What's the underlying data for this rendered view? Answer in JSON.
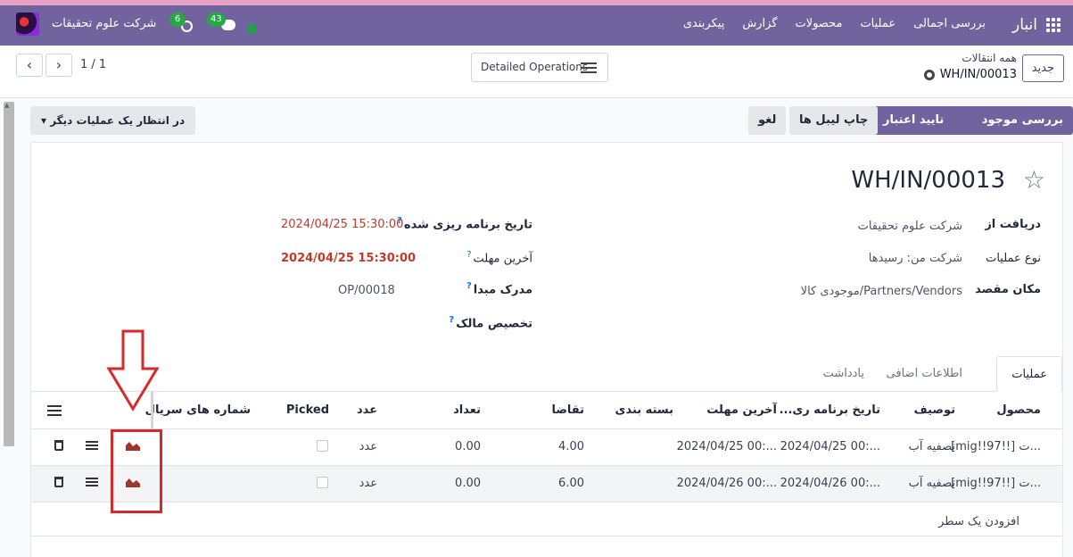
{
  "navbar": {
    "app_title": "انبار",
    "menu": [
      "بررسی اجمالی",
      "عملیات",
      "محصولات",
      "گزارش",
      "پیکربندی"
    ],
    "company": "شرکت علوم تحقیقات",
    "activity_count": "6",
    "message_count": "43"
  },
  "control": {
    "new_button": "جدید",
    "breadcrumb_parent": "همه انتقالات",
    "breadcrumb_current": "WH/IN/00013",
    "detailed_operations": "Detailed Operations",
    "pager": "1 / 1"
  },
  "actions": {
    "check_availability": "بررسی موجود بودن",
    "validate": "تایید اعتبار",
    "print_labels": "چاپ لیبل ها",
    "cancel": "لغو",
    "waiting": "در انتظار یک عملیات دیگر"
  },
  "record": {
    "name": "WH/IN/00013",
    "fields": {
      "receive_from_label": "دریافت از",
      "receive_from_value": "شرکت علوم تحقیقات",
      "operation_type_label": "نوع عملیات",
      "operation_type_value": "شرکت من: رسیدها",
      "destination_label": "مکان مقصد",
      "destination_value": "Partners/Vendors/موجودی کالا",
      "scheduled_date_label": "تاریخ برنامه ریزی شده",
      "scheduled_date_value": "2024/04/25 15:30:00",
      "deadline_label": "آخرین مهلت",
      "deadline_value": "2024/04/25 15:30:00",
      "source_document_label": "مدرک مبدا",
      "source_document_value": "OP/00018",
      "assign_owner_label": "تخصیص مالک"
    }
  },
  "tabs": [
    "عملیات",
    "اطلاعات اضافی",
    "یادداشت"
  ],
  "table": {
    "headers": {
      "product": "محصول",
      "description": "توصیف",
      "scheduled": "تاریخ برنامه ری...",
      "deadline": "آخرین مهلت",
      "package": "بسته بندی",
      "demand": "تقاضا",
      "quantity": "تعداد",
      "uom": "عدد",
      "picked": "Picked",
      "serial": "شماره های سریال"
    },
    "rows": [
      {
        "product": "[mig!!97!!] ت...",
        "description": "تصفیه آب",
        "scheduled": "2024/04/25 00:...",
        "deadline": "2024/04/25 00:...",
        "demand": "4.00",
        "quantity": "0.00",
        "uom": "عدد"
      },
      {
        "product": "[mig!!97!!] ت...",
        "description": "تصفیه آب",
        "scheduled": "2024/04/26 00:...",
        "deadline": "2024/04/26 00:...",
        "demand": "6.00",
        "quantity": "0.00",
        "uom": "عدد"
      }
    ],
    "add_line": "افزودن یک سطر"
  },
  "colors": {
    "brand": "#71639e",
    "annotation": "#d42a2a",
    "danger_text": "#c0392b"
  }
}
